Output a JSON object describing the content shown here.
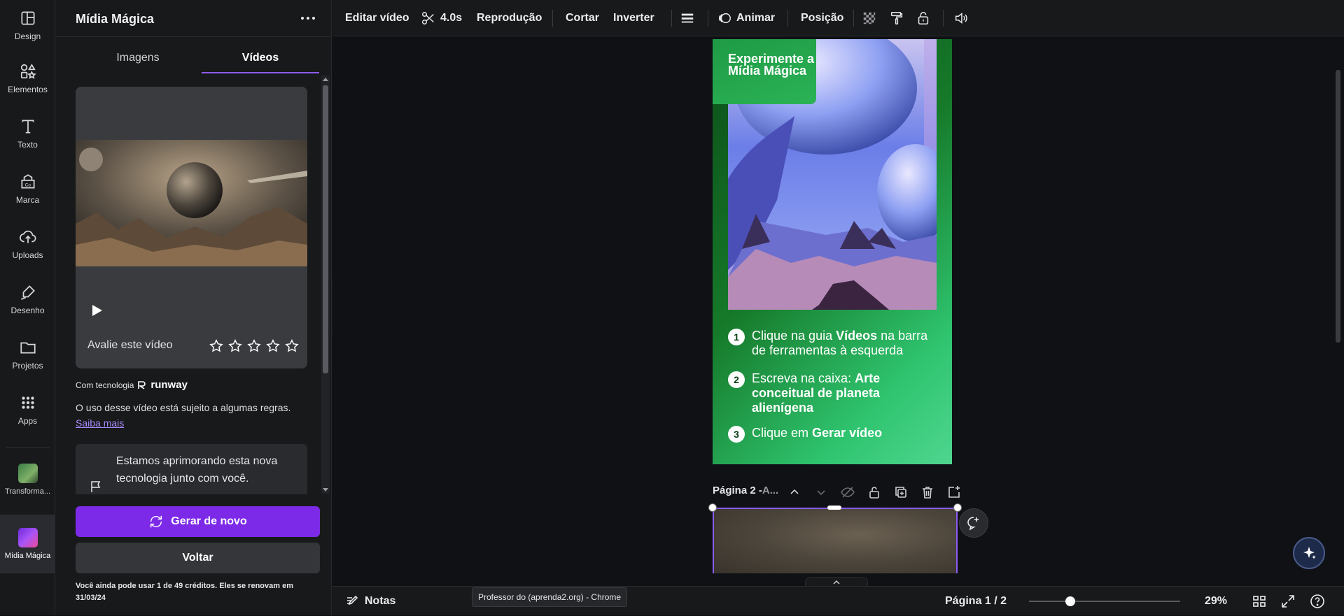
{
  "rail": {
    "items": [
      {
        "label": "Design",
        "icon": "layout-icon"
      },
      {
        "label": "Elementos",
        "icon": "shapes-icon"
      },
      {
        "label": "Texto",
        "icon": "text-icon"
      },
      {
        "label": "Marca",
        "icon": "brand-icon"
      },
      {
        "label": "Uploads",
        "icon": "upload-icon"
      },
      {
        "label": "Desenho",
        "icon": "draw-icon"
      },
      {
        "label": "Projetos",
        "icon": "folder-icon"
      },
      {
        "label": "Apps",
        "icon": "apps-icon"
      },
      {
        "label": "Transforma...",
        "icon": "app-thumbnail-icon"
      },
      {
        "label": "Mídia Mágica",
        "icon": "app-thumbnail-icon"
      }
    ]
  },
  "panel": {
    "title": "Mídia Mágica",
    "tabs": [
      "Imagens",
      "Vídeos"
    ],
    "active_tab": "Vídeos",
    "rate_label": "Avalie este vídeo",
    "rating_stars": 5,
    "powered_by": "Com tecnologia",
    "powered_brand": "runway",
    "terms_text": "O uso desse vídeo está sujeito a algumas regras.",
    "terms_link": "Saiba mais",
    "feedback_text": "Estamos aprimorando esta nova tecnologia junto com você.",
    "regenerate_label": "Gerar de novo",
    "back_label": "Voltar",
    "credits_text": "Você ainda pode usar 1 de 49 créditos. Eles se renovam em 31/03/24"
  },
  "toolbar": {
    "edit_video": "Editar vídeo",
    "duration": "4.0s",
    "playback": "Reprodução",
    "crop": "Cortar",
    "flip": "Inverter",
    "animate": "Animar",
    "position": "Posição"
  },
  "design": {
    "badge": "Experimente a Mídia Mágica",
    "steps": [
      {
        "num": "1",
        "pre": "Clique na guia ",
        "bold": "Vídeos",
        "post": " na barra de ferramentas à esquerda"
      },
      {
        "num": "2",
        "pre": "Escreva na caixa: ",
        "bold": "Arte conceitual de planeta alienígena",
        "post": ""
      },
      {
        "num": "3",
        "pre": "Clique em ",
        "bold": "Gerar vídeo",
        "post": ""
      }
    ]
  },
  "page2": {
    "label": "Página 2 - ",
    "title_truncated": "A..."
  },
  "footer": {
    "notes": "Notas",
    "tooltip": "Professor do (aprenda2.org) - Chrome",
    "page_indicator": "Página 1 / 2",
    "zoom": "29%",
    "zoom_fraction": 0.29
  },
  "colors": {
    "accent": "#7d2ae8",
    "tab_underline": "#8b5cf6",
    "link": "#a78bfa",
    "background": "#0f1115",
    "panel": "#18191b"
  }
}
